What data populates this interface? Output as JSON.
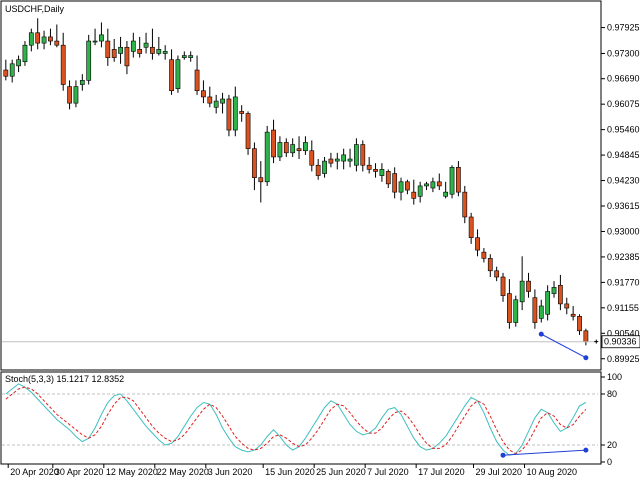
{
  "chart": {
    "symbol_title": "USDCHF,Daily",
    "price_axis_labels": [
      "0.97925",
      "0.97300",
      "0.96690",
      "0.96075",
      "0.95460",
      "0.94845",
      "0.94230",
      "0.93615",
      "0.93000",
      "0.92385",
      "0.91770",
      "0.91155",
      "0.90540",
      "0.89925"
    ],
    "current_price": "0.90336",
    "date_labels": [
      "20 Apr 2020",
      "30 Apr 2020",
      "12 May 2020",
      "22 May 2020",
      "3 Jun 2020",
      "15 Jun 2020",
      "25 Jun 2020",
      "7 Jul 2020",
      "17 Jul 2020",
      "29 Jul 2020",
      "10 Aug 2020"
    ],
    "colors": {
      "bull": "#2db34a",
      "bear": "#d9521f",
      "wick": "#000000",
      "divergence": "#1f3fd6",
      "main_line": "#3fbfbf",
      "signal_line": "#e02020",
      "grid": "#c0c0c0",
      "background": "#ffffff"
    }
  },
  "stochastic": {
    "label": "Stoch(5,3,3) 15.1217 12.8352",
    "axis_labels": [
      "100",
      "80",
      "20",
      "0"
    ]
  },
  "chart_data": {
    "type": "candlestick",
    "price_range": [
      0.8975,
      0.9835
    ],
    "candles": [
      {
        "o": 0.969,
        "h": 0.9715,
        "l": 0.9665,
        "c": 0.9675
      },
      {
        "o": 0.9675,
        "h": 0.9715,
        "l": 0.966,
        "c": 0.9705
      },
      {
        "o": 0.97,
        "h": 0.9725,
        "l": 0.9685,
        "c": 0.9715
      },
      {
        "o": 0.971,
        "h": 0.976,
        "l": 0.97,
        "c": 0.975
      },
      {
        "o": 0.975,
        "h": 0.979,
        "l": 0.9735,
        "c": 0.978
      },
      {
        "o": 0.978,
        "h": 0.9815,
        "l": 0.974,
        "c": 0.9755
      },
      {
        "o": 0.9755,
        "h": 0.9785,
        "l": 0.974,
        "c": 0.977
      },
      {
        "o": 0.977,
        "h": 0.979,
        "l": 0.975,
        "c": 0.976
      },
      {
        "o": 0.976,
        "h": 0.98,
        "l": 0.9745,
        "c": 0.975
      },
      {
        "o": 0.975,
        "h": 0.978,
        "l": 0.964,
        "c": 0.9655
      },
      {
        "o": 0.965,
        "h": 0.9665,
        "l": 0.9595,
        "c": 0.961
      },
      {
        "o": 0.961,
        "h": 0.9665,
        "l": 0.96,
        "c": 0.965
      },
      {
        "o": 0.9655,
        "h": 0.968,
        "l": 0.964,
        "c": 0.9665
      },
      {
        "o": 0.9665,
        "h": 0.9775,
        "l": 0.9655,
        "c": 0.976
      },
      {
        "o": 0.976,
        "h": 0.979,
        "l": 0.975,
        "c": 0.976
      },
      {
        "o": 0.976,
        "h": 0.9805,
        "l": 0.9745,
        "c": 0.9775
      },
      {
        "o": 0.976,
        "h": 0.979,
        "l": 0.97,
        "c": 0.972
      },
      {
        "o": 0.974,
        "h": 0.9765,
        "l": 0.971,
        "c": 0.972
      },
      {
        "o": 0.973,
        "h": 0.977,
        "l": 0.9705,
        "c": 0.9745
      },
      {
        "o": 0.9745,
        "h": 0.976,
        "l": 0.968,
        "c": 0.97
      },
      {
        "o": 0.9735,
        "h": 0.978,
        "l": 0.972,
        "c": 0.976
      },
      {
        "o": 0.974,
        "h": 0.977,
        "l": 0.972,
        "c": 0.973
      },
      {
        "o": 0.9745,
        "h": 0.978,
        "l": 0.973,
        "c": 0.9755
      },
      {
        "o": 0.9745,
        "h": 0.979,
        "l": 0.9715,
        "c": 0.973
      },
      {
        "o": 0.973,
        "h": 0.977,
        "l": 0.9725,
        "c": 0.974
      },
      {
        "o": 0.973,
        "h": 0.975,
        "l": 0.9715,
        "c": 0.9735
      },
      {
        "o": 0.9715,
        "h": 0.974,
        "l": 0.963,
        "c": 0.964
      },
      {
        "o": 0.9645,
        "h": 0.9725,
        "l": 0.9635,
        "c": 0.9715
      },
      {
        "o": 0.972,
        "h": 0.9735,
        "l": 0.9715,
        "c": 0.9725
      },
      {
        "o": 0.972,
        "h": 0.9735,
        "l": 0.971,
        "c": 0.9725
      },
      {
        "o": 0.969,
        "h": 0.9725,
        "l": 0.963,
        "c": 0.964
      },
      {
        "o": 0.964,
        "h": 0.9665,
        "l": 0.961,
        "c": 0.9625
      },
      {
        "o": 0.9625,
        "h": 0.965,
        "l": 0.96,
        "c": 0.961
      },
      {
        "o": 0.96,
        "h": 0.963,
        "l": 0.9585,
        "c": 0.9615
      },
      {
        "o": 0.961,
        "h": 0.9635,
        "l": 0.9585,
        "c": 0.962
      },
      {
        "o": 0.962,
        "h": 0.963,
        "l": 0.953,
        "c": 0.9545
      },
      {
        "o": 0.9545,
        "h": 0.965,
        "l": 0.953,
        "c": 0.9625
      },
      {
        "o": 0.959,
        "h": 0.9605,
        "l": 0.9565,
        "c": 0.9585
      },
      {
        "o": 0.9585,
        "h": 0.959,
        "l": 0.9485,
        "c": 0.95
      },
      {
        "o": 0.95,
        "h": 0.9515,
        "l": 0.94,
        "c": 0.943
      },
      {
        "o": 0.943,
        "h": 0.947,
        "l": 0.937,
        "c": 0.942
      },
      {
        "o": 0.942,
        "h": 0.9555,
        "l": 0.941,
        "c": 0.954
      },
      {
        "o": 0.9545,
        "h": 0.957,
        "l": 0.9465,
        "c": 0.948
      },
      {
        "o": 0.948,
        "h": 0.953,
        "l": 0.947,
        "c": 0.9515
      },
      {
        "o": 0.9515,
        "h": 0.9525,
        "l": 0.948,
        "c": 0.949
      },
      {
        "o": 0.949,
        "h": 0.9525,
        "l": 0.948,
        "c": 0.951
      },
      {
        "o": 0.95,
        "h": 0.953,
        "l": 0.9475,
        "c": 0.9495
      },
      {
        "o": 0.9495,
        "h": 0.953,
        "l": 0.9485,
        "c": 0.9515
      },
      {
        "o": 0.9495,
        "h": 0.952,
        "l": 0.9445,
        "c": 0.946
      },
      {
        "o": 0.946,
        "h": 0.9475,
        "l": 0.9425,
        "c": 0.9435
      },
      {
        "o": 0.944,
        "h": 0.948,
        "l": 0.943,
        "c": 0.947
      },
      {
        "o": 0.9475,
        "h": 0.949,
        "l": 0.9455,
        "c": 0.9465
      },
      {
        "o": 0.947,
        "h": 0.949,
        "l": 0.945,
        "c": 0.9475
      },
      {
        "o": 0.947,
        "h": 0.95,
        "l": 0.945,
        "c": 0.9485
      },
      {
        "o": 0.947,
        "h": 0.95,
        "l": 0.9455,
        "c": 0.9475
      },
      {
        "o": 0.946,
        "h": 0.9525,
        "l": 0.9445,
        "c": 0.951
      },
      {
        "o": 0.951,
        "h": 0.952,
        "l": 0.9445,
        "c": 0.946
      },
      {
        "o": 0.946,
        "h": 0.948,
        "l": 0.944,
        "c": 0.945
      },
      {
        "o": 0.945,
        "h": 0.9465,
        "l": 0.943,
        "c": 0.9445
      },
      {
        "o": 0.9435,
        "h": 0.9465,
        "l": 0.942,
        "c": 0.945
      },
      {
        "o": 0.9445,
        "h": 0.945,
        "l": 0.9405,
        "c": 0.9415
      },
      {
        "o": 0.944,
        "h": 0.9455,
        "l": 0.938,
        "c": 0.9395
      },
      {
        "o": 0.9395,
        "h": 0.943,
        "l": 0.9375,
        "c": 0.942
      },
      {
        "o": 0.942,
        "h": 0.9425,
        "l": 0.939,
        "c": 0.94
      },
      {
        "o": 0.9395,
        "h": 0.9425,
        "l": 0.9365,
        "c": 0.938
      },
      {
        "o": 0.9385,
        "h": 0.942,
        "l": 0.937,
        "c": 0.941
      },
      {
        "o": 0.941,
        "h": 0.942,
        "l": 0.94,
        "c": 0.9415
      },
      {
        "o": 0.9405,
        "h": 0.943,
        "l": 0.9395,
        "c": 0.942
      },
      {
        "o": 0.942,
        "h": 0.944,
        "l": 0.94,
        "c": 0.941
      },
      {
        "o": 0.9385,
        "h": 0.942,
        "l": 0.938,
        "c": 0.9395
      },
      {
        "o": 0.939,
        "h": 0.946,
        "l": 0.938,
        "c": 0.9455
      },
      {
        "o": 0.9455,
        "h": 0.947,
        "l": 0.9385,
        "c": 0.9395
      },
      {
        "o": 0.9395,
        "h": 0.941,
        "l": 0.932,
        "c": 0.9335
      },
      {
        "o": 0.9335,
        "h": 0.9345,
        "l": 0.927,
        "c": 0.9285
      },
      {
        "o": 0.9285,
        "h": 0.9305,
        "l": 0.924,
        "c": 0.9255
      },
      {
        "o": 0.925,
        "h": 0.926,
        "l": 0.9225,
        "c": 0.9235
      },
      {
        "o": 0.9235,
        "h": 0.9245,
        "l": 0.919,
        "c": 0.9205
      },
      {
        "o": 0.9205,
        "h": 0.9215,
        "l": 0.918,
        "c": 0.919
      },
      {
        "o": 0.919,
        "h": 0.92,
        "l": 0.913,
        "c": 0.9145
      },
      {
        "o": 0.915,
        "h": 0.9185,
        "l": 0.9065,
        "c": 0.908
      },
      {
        "o": 0.908,
        "h": 0.9145,
        "l": 0.907,
        "c": 0.9135
      },
      {
        "o": 0.913,
        "h": 0.924,
        "l": 0.911,
        "c": 0.918
      },
      {
        "o": 0.918,
        "h": 0.92,
        "l": 0.914,
        "c": 0.9155
      },
      {
        "o": 0.914,
        "h": 0.916,
        "l": 0.9065,
        "c": 0.908
      },
      {
        "o": 0.909,
        "h": 0.9135,
        "l": 0.908,
        "c": 0.912
      },
      {
        "o": 0.91,
        "h": 0.917,
        "l": 0.9085,
        "c": 0.9155
      },
      {
        "o": 0.915,
        "h": 0.918,
        "l": 0.914,
        "c": 0.9165
      },
      {
        "o": 0.917,
        "h": 0.9195,
        "l": 0.911,
        "c": 0.9125
      },
      {
        "o": 0.9125,
        "h": 0.914,
        "l": 0.91,
        "c": 0.9115
      },
      {
        "o": 0.91,
        "h": 0.912,
        "l": 0.9085,
        "c": 0.9095
      },
      {
        "o": 0.9095,
        "h": 0.91,
        "l": 0.905,
        "c": 0.906
      },
      {
        "o": 0.906,
        "h": 0.9065,
        "l": 0.9025,
        "c": 0.9034
      }
    ],
    "divergence_price": {
      "from_index": 84,
      "from_value": 0.9052,
      "to_index": 91,
      "to_value": 0.8995
    },
    "stochastic": {
      "main": [
        80,
        86,
        92,
        88,
        82,
        74,
        66,
        58,
        50,
        44,
        38,
        30,
        24,
        28,
        40,
        56,
        70,
        78,
        80,
        72,
        62,
        52,
        42,
        34,
        26,
        20,
        22,
        30,
        42,
        54,
        64,
        70,
        68,
        56,
        40,
        28,
        18,
        14,
        12,
        14,
        20,
        30,
        38,
        30,
        20,
        14,
        18,
        28,
        40,
        52,
        64,
        72,
        68,
        56,
        44,
        36,
        32,
        34,
        40,
        52,
        62,
        64,
        56,
        42,
        28,
        18,
        14,
        16,
        22,
        30,
        42,
        54,
        66,
        76,
        72,
        58,
        40,
        24,
        14,
        8,
        10,
        20,
        36,
        52,
        62,
        58,
        46,
        36,
        40,
        52,
        66,
        70
      ],
      "signal": [
        74,
        80,
        86,
        88,
        86,
        80,
        72,
        64,
        56,
        50,
        44,
        38,
        32,
        28,
        32,
        42,
        56,
        68,
        76,
        76,
        72,
        62,
        52,
        42,
        34,
        28,
        24,
        26,
        32,
        42,
        52,
        62,
        68,
        64,
        54,
        42,
        30,
        22,
        16,
        14,
        16,
        22,
        30,
        32,
        28,
        22,
        18,
        20,
        28,
        38,
        50,
        62,
        68,
        66,
        58,
        48,
        40,
        34,
        34,
        40,
        50,
        58,
        60,
        54,
        44,
        32,
        22,
        16,
        16,
        20,
        30,
        42,
        54,
        66,
        72,
        68,
        54,
        38,
        24,
        14,
        10,
        14,
        24,
        38,
        52,
        58,
        54,
        44,
        40,
        44,
        54,
        62
      ],
      "divergence": {
        "from_index": 78,
        "from_value": 8,
        "to_index": 91,
        "to_value": 14
      },
      "levels": [
        20,
        80
      ],
      "range": [
        0,
        100
      ]
    }
  }
}
